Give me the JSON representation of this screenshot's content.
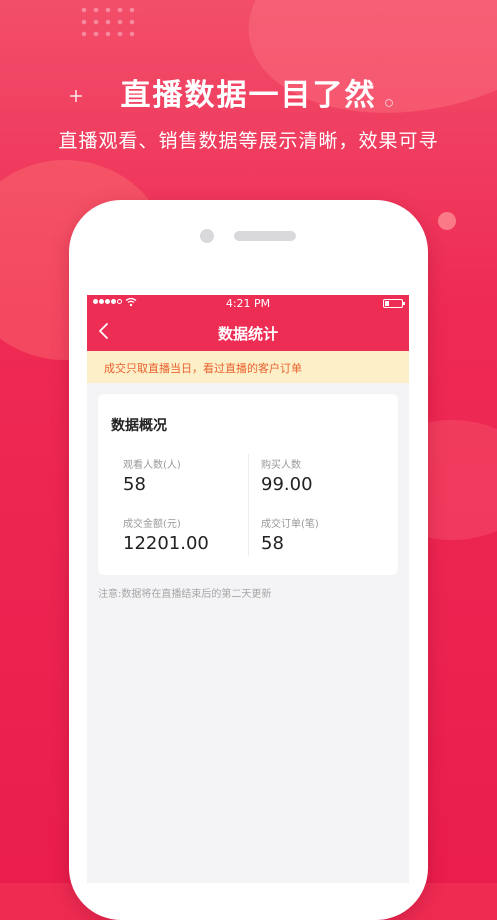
{
  "promo": {
    "headline": "直播数据一目了然",
    "subheadline": "直播观看、销售数据等展示清晰，效果可寻"
  },
  "status_bar": {
    "time": "4:21 PM"
  },
  "app_bar": {
    "title": "数据统计",
    "back_icon": "chevron-left-icon"
  },
  "notice": {
    "text": "成交只取直播当日，看过直播的客户订单"
  },
  "overview": {
    "title": "数据概况",
    "metrics": [
      {
        "label": "观看人数(人)",
        "value": "58"
      },
      {
        "label": "购买人数",
        "value": "99.00"
      },
      {
        "label": "成交金额(元)",
        "value": "12201.00"
      },
      {
        "label": "成交订单(笔)",
        "value": "58"
      }
    ]
  },
  "footnote": "注意:数据将在直播结束后的第二天更新",
  "colors": {
    "brand_red": "#ee2d55",
    "notice_bg": "#fdefc8",
    "notice_text": "#e9622f"
  }
}
